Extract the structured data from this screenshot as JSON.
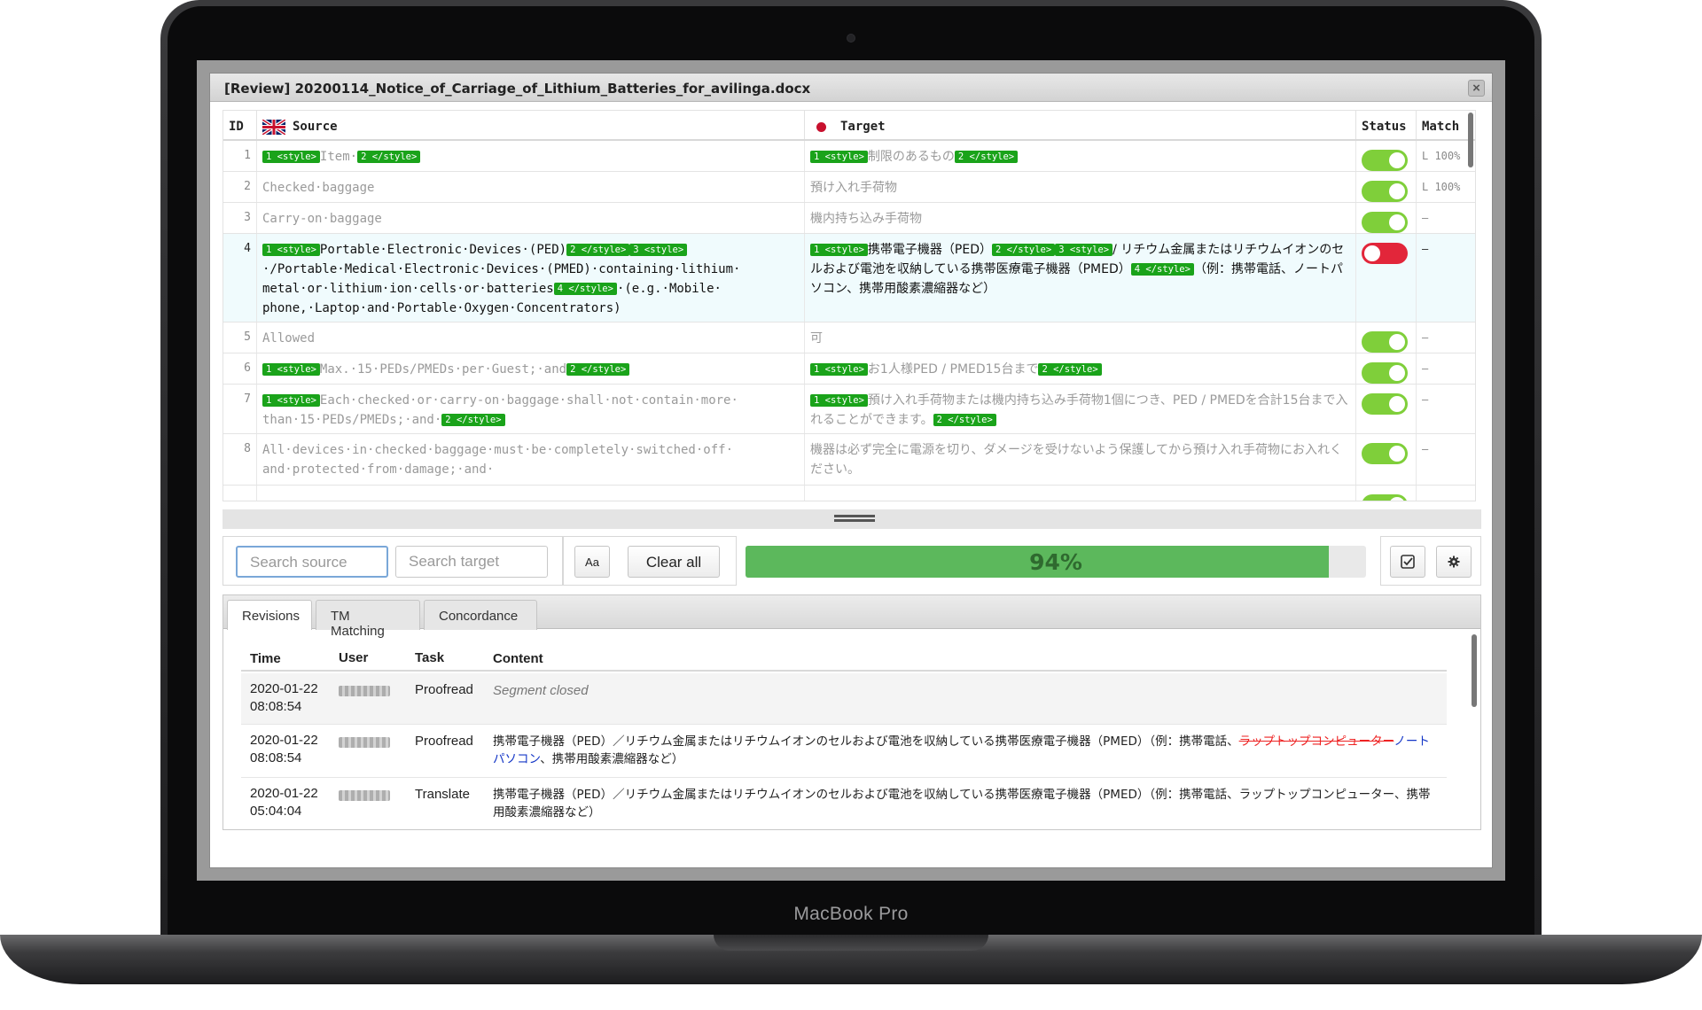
{
  "device": {
    "label": "MacBook Pro"
  },
  "dialog": {
    "title": "[Review] 20200114_Notice_of_Carriage_of_Lithium_Batteries_for_avilinga.docx",
    "close_glyph": "×"
  },
  "grid": {
    "headers": {
      "id": "ID",
      "source": "Source",
      "target": "Target",
      "status": "Status",
      "match": "Match"
    },
    "source_flag": "uk-flag-icon",
    "target_flag": "japan-flag-icon",
    "rows": [
      {
        "id": "1",
        "status": "confirmed",
        "match": "L 100%"
      },
      {
        "id": "2",
        "source": "Checked·baggage",
        "target": "預け入れ手荷物",
        "status": "confirmed",
        "match": "L 100%"
      },
      {
        "id": "3",
        "source": "Carry-on·baggage",
        "target": "機内持ち込み手荷物",
        "status": "confirmed",
        "match": "–"
      },
      {
        "id": "4",
        "status": "rejected",
        "match": "–"
      },
      {
        "id": "5",
        "source": "Allowed",
        "target": "可",
        "status": "confirmed",
        "match": "–"
      },
      {
        "id": "6",
        "status": "confirmed",
        "match": "–"
      },
      {
        "id": "7",
        "status": "confirmed",
        "match": "–"
      },
      {
        "id": "8",
        "source": "All·devices·in·checked·baggage·must·be·completely·switched·off· and·protected·from·damage;·and·",
        "target": "機器は必ず完全に電源を切り、ダメージを受けないよう保護してから預け入れ手荷物にお入れください。",
        "status": "confirmed",
        "match": "–"
      }
    ],
    "segments": {
      "r1_src_t1": "1 <style>",
      "r1_src_text": "Item·",
      "r1_src_t2": "2 </style>",
      "r1_tgt_t1": "1 <style>",
      "r1_tgt_text": "制限のあるもの",
      "r1_tgt_t2": "2 </style>",
      "r4_src_t1": "1 <style>",
      "r4_src_a": "Portable·Electronic·Devices·(PED)",
      "r4_src_t2": "2 </style>",
      "r4_src_t3": "3 <style>",
      "r4_src_b": "·/Portable·Medical·Electronic·Devices·(PMED)·containing·lithium· metal·or·lithium·ion·cells·or·batteries",
      "r4_src_t4": "4 </style>",
      "r4_src_c": "·(e.g.·Mobile· phone,·Laptop·and·Portable·Oxygen·Concentrators)",
      "r4_tgt_t1": "1 <style>",
      "r4_tgt_a": "携帯電子機器（PED）",
      "r4_tgt_t2": "2 </style>",
      "r4_tgt_t3": "3 <style>",
      "r4_tgt_b": "/ リチウム金属またはリチウムイオンのセルおよび電池を収納している携帯医療電子機器（PMED）",
      "r4_tgt_t4": "4 </style>",
      "r4_tgt_c": "（例：携帯電話、ノートパソコン、携帯用酸素濃縮器など）",
      "r6_src_t1": "1 <style>",
      "r6_src_text": "Max.·15·PEDs/PMEDs·per·Guest;·and",
      "r6_src_t2": "2 </style>",
      "r6_tgt_t1": "1 <style>",
      "r6_tgt_text": "お1人様PED / PMED15台まで",
      "r6_tgt_t2": "2 </style>",
      "r7_src_t1": "1 <style>",
      "r7_src_text": "Each·checked·or·carry-on·baggage·shall·not·contain·more· than·15·PEDs/PMEDs;·and·",
      "r7_src_t2": "2 </style>",
      "r7_tgt_t1": "1 <style>",
      "r7_tgt_text": "預け入れ手荷物または機内持ち込み手荷物1個につき、PED / PMEDを合計15台まで入れることができます。",
      "r7_tgt_t2": "2 </style>"
    }
  },
  "search": {
    "source_placeholder": "Search source",
    "target_placeholder": "Search target",
    "case_button": "Aa",
    "clear_button": "Clear all",
    "progress_value": 0.94,
    "progress_label": "94%",
    "confirm_icon": "checkbox-icon",
    "settings_icon": "gear-icon"
  },
  "panel": {
    "tabs": [
      "Revisions",
      "TM Matching",
      "Concordance"
    ],
    "active_tab": "Revisions",
    "headers": {
      "time": "Time",
      "user": "User",
      "task": "Task",
      "content": "Content"
    },
    "revisions": [
      {
        "date": "2020-01-22",
        "time": "08:08:54",
        "task": "Proofread",
        "content": "Segment closed"
      },
      {
        "date": "2020-01-22",
        "time": "08:08:54",
        "task": "Proofread",
        "content_a": "携帯電子機器（PED）／リチウム金属またはリチウムイオンのセルおよび電池を収納している携帯医療電子機器（PMED）（例：携帯電話、",
        "deleted": "ラップトップコンピューター",
        "inserted": "ノートパソコン",
        "content_b": "、携帯用酸素濃縮器など）"
      },
      {
        "date": "2020-01-22",
        "time": "05:04:04",
        "task": "Translate",
        "content": "携帯電子機器（PED）／リチウム金属またはリチウムイオンのセルおよび電池を収納している携帯医療電子機器（PMED）（例：携帯電話、ラップトップコンピューター、携帯用酸素濃縮器など）"
      }
    ]
  },
  "colors": {
    "tag_green": "#1aa31a",
    "toggle_on": "#7fcf3a",
    "toggle_off": "#e2263a",
    "progress": "#5cb85c",
    "deletion": "#e22222",
    "insertion": "#1537c7"
  }
}
